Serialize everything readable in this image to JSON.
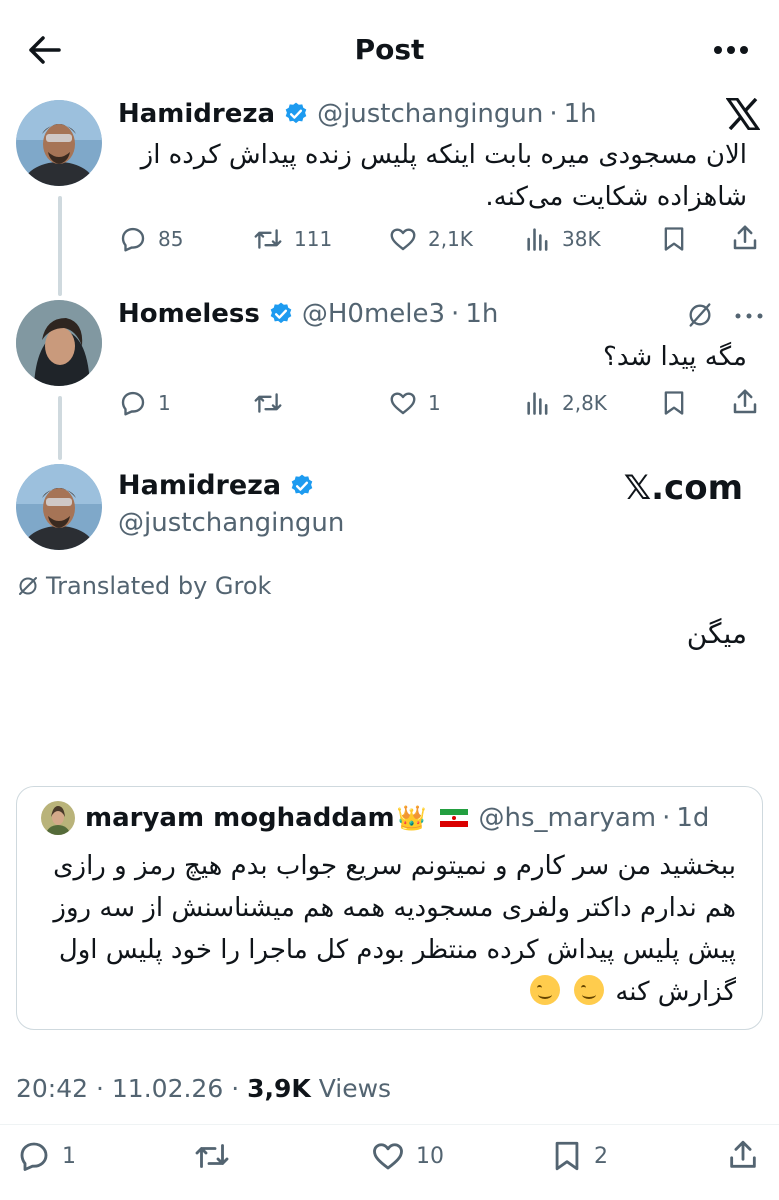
{
  "header": {
    "title": "Post"
  },
  "tweets": [
    {
      "name": "Hamidreza",
      "handle": "@justchangingun",
      "time": "1h",
      "text_line1": "الان مسجودی میره بابت اینکه پلیس زنده پیداش کرده از",
      "text_line2": "شاهزاده شکایت می‌کنه.",
      "replies": "85",
      "reposts": "111",
      "likes": "2,1K",
      "views": "38K"
    },
    {
      "name": "Homeless",
      "handle": "@H0mele3",
      "time": "1h",
      "text": "مگه پیدا شد؟",
      "replies": "1",
      "reposts": "",
      "likes": "1",
      "views": "2,8K"
    }
  ],
  "main_post": {
    "name": "Hamidreza",
    "handle": "@justchangingun",
    "brand": "𝕏.com",
    "translated_label": "Translated by Grok",
    "text": "میگن",
    "quote": {
      "name": "maryam moghaddam",
      "flag_emoji": "👑",
      "handle": "@hs_maryam",
      "time": "1d",
      "line1": "ببخشید من سر کارم و نمیتونم سریع جواب بدم هیچ رمز و رازی",
      "line2": "هم ندارم داکتر ولفری مسجودیه همه هم میشناسنش از سه روز",
      "line3": "پیش پلیس پیداش کرده منتظر بودم کل ماجرا را خود پلیس اول",
      "line4": "گزارش کنه"
    },
    "timestamp": "20:42",
    "date": "11.02.26",
    "views_count": "3,9K",
    "views_label": "Views",
    "replies": "1",
    "reposts": "",
    "likes": "10",
    "bookmarks": "2"
  },
  "colors": {
    "text": "#0f1419",
    "secondary": "#536471",
    "verified": "#1d9bf0",
    "border": "#cfd9de"
  },
  "icons": [
    "back-arrow-icon",
    "more-icon",
    "verified-icon",
    "x-logo-icon",
    "grok-icon",
    "reply-icon",
    "repost-icon",
    "like-icon",
    "views-icon",
    "bookmark-icon",
    "share-icon"
  ]
}
